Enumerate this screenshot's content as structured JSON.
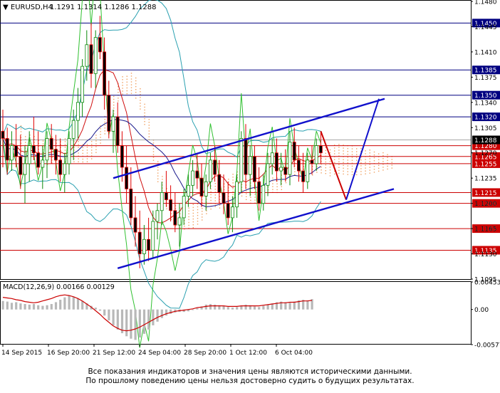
{
  "chart_data": [
    {
      "type": "candlestick",
      "title": "EURUSD,H4",
      "ohlc_header": [
        "1.1291",
        "1.1314",
        "1.1286",
        "1.1288"
      ],
      "ylim": [
        1.1095,
        1.148
      ],
      "y_ticks": [
        1.148,
        1.1445,
        1.141,
        1.1375,
        1.134,
        1.1305,
        1.127,
        1.1235,
        1.12,
        1.1165,
        1.113,
        1.1095
      ],
      "x_ticks": [
        "14 Sep 2015",
        "16 Sep 20:00",
        "21 Sep 12:00",
        "24 Sep 04:00",
        "28 Sep 20:00",
        "1 Oct 12:00",
        "6 Oct 04:00"
      ],
      "current_price": 1.1288,
      "colors": {
        "up": "#0b8a0b",
        "down": "#e00000",
        "grid": "#e6e6e6",
        "ichimoku": "#f0a060",
        "support_resistance": "#cc0000",
        "key_levels": "#000080",
        "channel": "#1010cc",
        "bollinger": "#2aa0b0",
        "ma_fast": "#d01010",
        "ma_slow": "#1a1a8c",
        "rsi_like": "#30c030"
      },
      "levels": [
        {
          "price": 1.145,
          "label": "1.1450",
          "kind": "blue"
        },
        {
          "price": 1.1385,
          "label": "1.1385",
          "kind": "blue"
        },
        {
          "price": 1.135,
          "label": "1.1350",
          "kind": "blue"
        },
        {
          "price": 1.132,
          "label": "1.1320",
          "kind": "blue"
        },
        {
          "price": 1.128,
          "label": "1.1280",
          "kind": "red"
        },
        {
          "price": 1.1265,
          "label": "1.1265",
          "kind": "red"
        },
        {
          "price": 1.1255,
          "label": "1.1255",
          "kind": "red"
        },
        {
          "price": 1.1215,
          "label": "1.1215",
          "kind": "red"
        },
        {
          "price": 1.12,
          "label": "1.1200",
          "kind": "red"
        },
        {
          "price": 1.1165,
          "label": "1.1165",
          "kind": "red"
        },
        {
          "price": 1.1135,
          "label": "1.1135",
          "kind": "red"
        }
      ],
      "candles": [
        [
          1.13,
          1.133,
          1.125,
          1.129
        ],
        [
          1.129,
          1.1305,
          1.124,
          1.126
        ],
        [
          1.126,
          1.13,
          1.1245,
          1.128
        ],
        [
          1.128,
          1.131,
          1.125,
          1.1265
        ],
        [
          1.1265,
          1.1295,
          1.122,
          1.124
        ],
        [
          1.124,
          1.128,
          1.12,
          1.1255
        ],
        [
          1.1255,
          1.13,
          1.123,
          1.128
        ],
        [
          1.128,
          1.132,
          1.126,
          1.127
        ],
        [
          1.127,
          1.13,
          1.124,
          1.125
        ],
        [
          1.125,
          1.128,
          1.122,
          1.126
        ],
        [
          1.126,
          1.13,
          1.1235,
          1.129
        ],
        [
          1.129,
          1.131,
          1.1255,
          1.1275
        ],
        [
          1.1275,
          1.1295,
          1.124,
          1.126
        ],
        [
          1.126,
          1.129,
          1.123,
          1.124
        ],
        [
          1.124,
          1.127,
          1.1215,
          1.1255
        ],
        [
          1.1255,
          1.13,
          1.124,
          1.129
        ],
        [
          1.129,
          1.133,
          1.126,
          1.1315
        ],
        [
          1.1315,
          1.136,
          1.129,
          1.134
        ],
        [
          1.134,
          1.14,
          1.132,
          1.139
        ],
        [
          1.139,
          1.144,
          1.137,
          1.142
        ],
        [
          1.142,
          1.145,
          1.136,
          1.138
        ],
        [
          1.138,
          1.144,
          1.136,
          1.143
        ],
        [
          1.143,
          1.146,
          1.14,
          1.141
        ],
        [
          1.141,
          1.143,
          1.133,
          1.135
        ],
        [
          1.135,
          1.137,
          1.129,
          1.13
        ],
        [
          1.13,
          1.133,
          1.127,
          1.132
        ],
        [
          1.132,
          1.134,
          1.127,
          1.128
        ],
        [
          1.128,
          1.13,
          1.123,
          1.125
        ],
        [
          1.125,
          1.128,
          1.12,
          1.122
        ],
        [
          1.122,
          1.125,
          1.117,
          1.118
        ],
        [
          1.118,
          1.121,
          1.114,
          1.116
        ],
        [
          1.116,
          1.119,
          1.111,
          1.113
        ],
        [
          1.113,
          1.117,
          1.1115,
          1.115
        ],
        [
          1.115,
          1.118,
          1.112,
          1.1135
        ],
        [
          1.1135,
          1.119,
          1.1125,
          1.1175
        ],
        [
          1.1175,
          1.12,
          1.115,
          1.119
        ],
        [
          1.119,
          1.123,
          1.117,
          1.1215
        ],
        [
          1.1215,
          1.1245,
          1.1195,
          1.1205
        ],
        [
          1.1205,
          1.1225,
          1.1175,
          1.119
        ],
        [
          1.119,
          1.1215,
          1.116,
          1.117
        ],
        [
          1.117,
          1.12,
          1.114,
          1.118
        ],
        [
          1.118,
          1.122,
          1.117,
          1.121
        ],
        [
          1.121,
          1.124,
          1.1195,
          1.1225
        ],
        [
          1.1225,
          1.126,
          1.121,
          1.1245
        ],
        [
          1.1245,
          1.127,
          1.122,
          1.1235
        ],
        [
          1.1235,
          1.1255,
          1.1195,
          1.121
        ],
        [
          1.121,
          1.124,
          1.119,
          1.123
        ],
        [
          1.123,
          1.127,
          1.122,
          1.126
        ],
        [
          1.126,
          1.128,
          1.123,
          1.124
        ],
        [
          1.124,
          1.126,
          1.12,
          1.1215
        ],
        [
          1.1215,
          1.124,
          1.1185,
          1.12
        ],
        [
          1.12,
          1.123,
          1.117,
          1.118
        ],
        [
          1.118,
          1.121,
          1.116,
          1.1195
        ],
        [
          1.1195,
          1.124,
          1.118,
          1.123
        ],
        [
          1.123,
          1.13,
          1.1215,
          1.129
        ],
        [
          1.129,
          1.131,
          1.122,
          1.124
        ],
        [
          1.124,
          1.128,
          1.121,
          1.1265
        ],
        [
          1.1265,
          1.128,
          1.122,
          1.123
        ],
        [
          1.123,
          1.125,
          1.119,
          1.12
        ],
        [
          1.12,
          1.124,
          1.119,
          1.1225
        ],
        [
          1.1225,
          1.127,
          1.121,
          1.1255
        ],
        [
          1.1255,
          1.129,
          1.124,
          1.127
        ],
        [
          1.127,
          1.129,
          1.123,
          1.1245
        ],
        [
          1.1245,
          1.127,
          1.1225,
          1.125
        ],
        [
          1.125,
          1.1275,
          1.123,
          1.124
        ],
        [
          1.124,
          1.13,
          1.1225,
          1.1285
        ],
        [
          1.1285,
          1.1305,
          1.125,
          1.126
        ],
        [
          1.126,
          1.128,
          1.123,
          1.1245
        ],
        [
          1.1245,
          1.127,
          1.1215,
          1.123
        ],
        [
          1.123,
          1.127,
          1.122,
          1.126
        ],
        [
          1.126,
          1.128,
          1.124,
          1.1255
        ],
        [
          1.1255,
          1.129,
          1.1245,
          1.128
        ],
        [
          1.128,
          1.13,
          1.1255,
          1.127
        ]
      ],
      "macd": {
        "label": "MACD(12,26,9) 0.00166 0.00129",
        "ylim": [
          -0.00577,
          0.00453
        ],
        "y_ticks": [
          0.00453,
          0.0,
          -0.00577
        ],
        "y_tick_labels": [
          "0.00453",
          "0.00",
          "-0.00577"
        ],
        "histogram": [
          0.0014,
          0.0013,
          0.0011,
          0.0012,
          0.001,
          0.0009,
          0.0008,
          0.0009,
          0.0007,
          0.0006,
          0.0007,
          0.0009,
          0.0012,
          0.0016,
          0.002,
          0.0023,
          0.0021,
          0.0018,
          0.0014,
          0.001,
          0.0006,
          0.0003,
          -0.0002,
          -0.001,
          -0.0018,
          -0.0026,
          -0.0033,
          -0.0039,
          -0.0044,
          -0.0048,
          -0.005,
          -0.0046,
          -0.004,
          -0.0033,
          -0.0026,
          -0.002,
          -0.0014,
          -0.001,
          -0.0007,
          -0.0005,
          -0.0004,
          -0.0004,
          -0.0003,
          -0.0001,
          0.0002,
          0.0005,
          0.0008,
          0.0009,
          0.0008,
          0.0007,
          0.0006,
          0.0004,
          0.0003,
          0.0004,
          0.0006,
          0.0008,
          0.0007,
          0.0005,
          0.0004,
          0.0006,
          0.0008,
          0.001,
          0.0012,
          0.0013,
          0.0012,
          0.0011,
          0.0013,
          0.0015,
          0.0016,
          0.0015,
          0.0017
        ],
        "signal": [
          0.002,
          0.0019,
          0.0018,
          0.0016,
          0.0015,
          0.0013,
          0.0012,
          0.0011,
          0.0012,
          0.0014,
          0.0016,
          0.0018,
          0.0021,
          0.0023,
          0.0024,
          0.0023,
          0.0021,
          0.0018,
          0.0014,
          0.0009,
          0.0004,
          -0.0002,
          -0.0008,
          -0.0015,
          -0.0021,
          -0.0027,
          -0.0031,
          -0.0034,
          -0.0035,
          -0.0034,
          -0.0032,
          -0.0029,
          -0.0025,
          -0.0021,
          -0.0017,
          -0.0013,
          -0.001,
          -0.0007,
          -0.0005,
          -0.0003,
          -0.0002,
          -0.0001,
          0.0,
          0.0001,
          0.0003,
          0.0004,
          0.0005,
          0.0006,
          0.0006,
          0.0006,
          0.0006,
          0.0005,
          0.0005,
          0.0005,
          0.0006,
          0.0006,
          0.0006,
          0.0006,
          0.0006,
          0.0007,
          0.0008,
          0.0009,
          0.001,
          0.0011,
          0.0011,
          0.0012,
          0.0012,
          0.0013,
          0.0014,
          0.0014,
          0.0015
        ]
      },
      "annotations": {
        "channel_top": [
          [
            1.1235,
            1.1345
          ]
        ],
        "channel_bottom": [
          [
            1.111,
            1.122
          ]
        ]
      }
    }
  ],
  "footer": {
    "line1": "Все показания индикаторов и значения цены являются историческими данными.",
    "line2": "По прошлому поведению цены нельзя достоверно судить о будущих результатах."
  }
}
